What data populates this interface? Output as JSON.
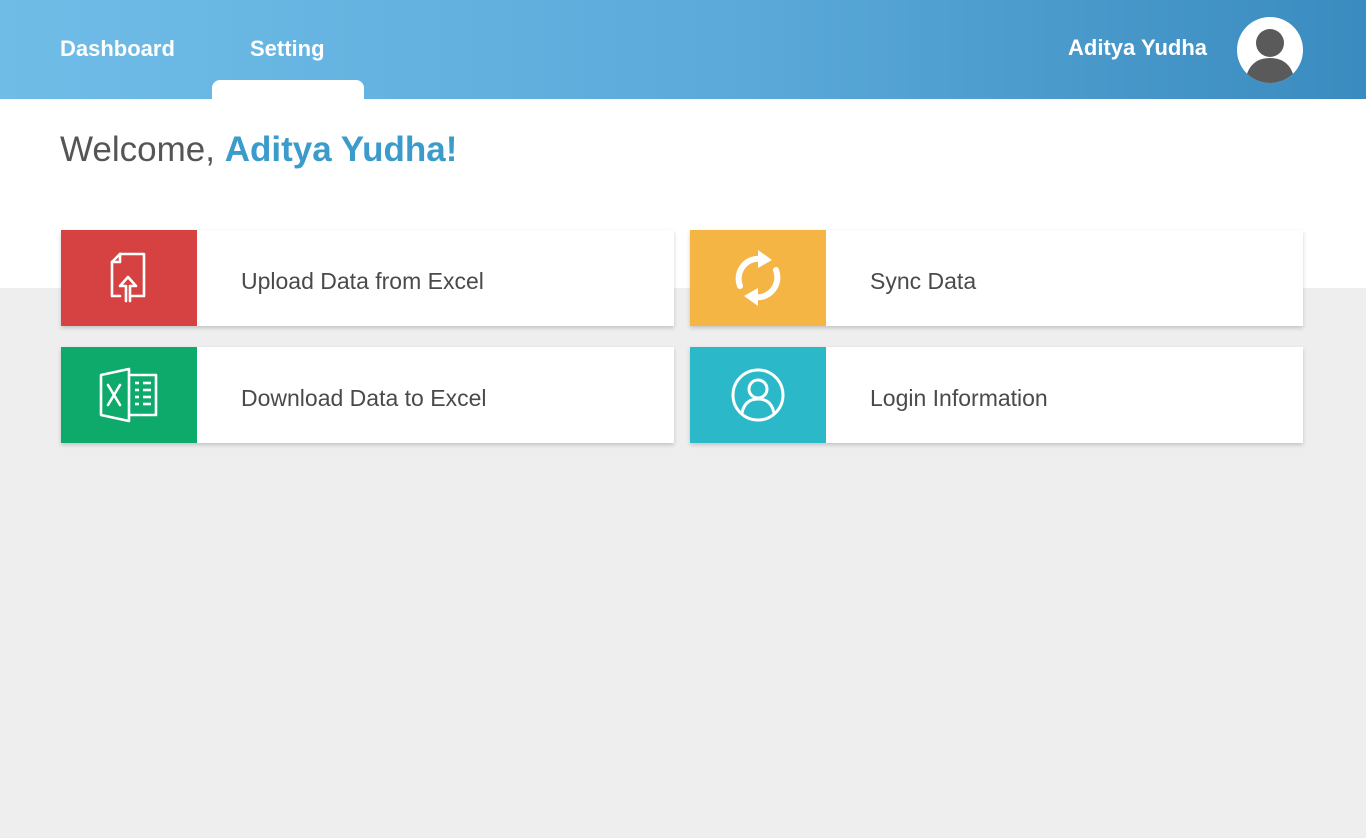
{
  "nav": {
    "tabs": [
      {
        "label": "Dashboard"
      },
      {
        "label": "Setting"
      }
    ]
  },
  "user": {
    "name": "Aditya Yudha"
  },
  "welcome": {
    "prefix": "Welcome, ",
    "name": "Aditya Yudha!"
  },
  "cards": [
    {
      "label": "Upload Data from Excel",
      "icon": "file-upload-icon",
      "color": "#d64242"
    },
    {
      "label": "Sync Data",
      "icon": "sync-icon",
      "color": "#f5b544"
    },
    {
      "label": "Download Data to Excel",
      "icon": "excel-icon",
      "color": "#0eaa6b"
    },
    {
      "label": "Login Information",
      "icon": "user-circle-icon",
      "color": "#2bb9ca"
    }
  ],
  "colors": {
    "header_start": "#6fbde7",
    "header_end": "#3a8bbf",
    "accent_text": "#3b9ccc",
    "background": "#eeeeee"
  }
}
